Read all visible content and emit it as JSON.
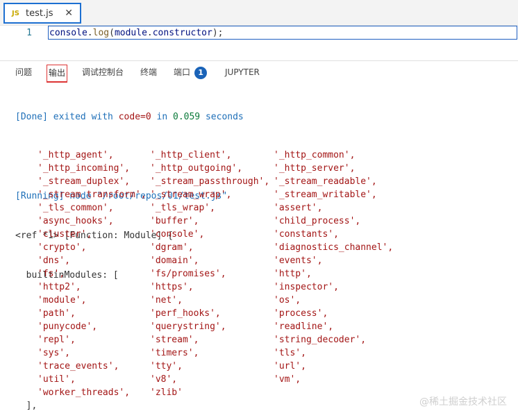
{
  "tab": {
    "icon": "JS",
    "file_name": "test.js",
    "close": "✕"
  },
  "editor": {
    "line_number": "1",
    "code": {
      "object": "console",
      "dot1": ".",
      "method": "log",
      "open": "(",
      "arg_obj": "module",
      "dot2": ".",
      "arg_prop": "constructor",
      "close": ");"
    }
  },
  "panel": {
    "tabs": [
      "问题",
      "输出",
      "调试控制台",
      "终端",
      "端口",
      "JUPYTER"
    ],
    "ports_badge": "1"
  },
  "output": {
    "done_tag": "[Done]",
    "done_text": " exited with ",
    "code_label": "code=0",
    "done_in": " in ",
    "done_seconds": "0.059",
    "done_unit": " seconds",
    "running_tag": "[Running]",
    "running_cmd": " node \"/root/repos/01/test.js\"",
    "ref_line": "<ref *1> [Function: Module] {",
    "builtin_header": "  builtinModules: [",
    "modules": [
      [
        "'_http_agent',",
        "'_http_client',",
        "'_http_common',"
      ],
      [
        "'_http_incoming',",
        "'_http_outgoing',",
        "'_http_server',"
      ],
      [
        "'_stream_duplex',",
        "'_stream_passthrough',",
        "'_stream_readable',"
      ],
      [
        "'_stream_transform',",
        "'_stream_wrap',",
        "'_stream_writable',"
      ],
      [
        "'_tls_common',",
        "'_tls_wrap',",
        "'assert',"
      ],
      [
        "'async_hooks',",
        "'buffer',",
        "'child_process',"
      ],
      [
        "'cluster',",
        "'console',",
        "'constants',"
      ],
      [
        "'crypto',",
        "'dgram',",
        "'diagnostics_channel',"
      ],
      [
        "'dns',",
        "'domain',",
        "'events',"
      ],
      [
        "'fs',",
        "'fs/promises',",
        "'http',"
      ],
      [
        "'http2',",
        "'https',",
        "'inspector',"
      ],
      [
        "'module',",
        "'net',",
        "'os',"
      ],
      [
        "'path',",
        "'perf_hooks',",
        "'process',"
      ],
      [
        "'punycode',",
        "'querystring',",
        "'readline',"
      ],
      [
        "'repl',",
        "'stream',",
        "'string_decoder',"
      ],
      [
        "'sys',",
        "'timers',",
        "'tls',"
      ],
      [
        "'trace_events',",
        "'tty',",
        "'url',"
      ],
      [
        "'util',",
        "'v8',",
        "'vm',"
      ],
      [
        "'worker_threads',",
        "'zlib'",
        ""
      ]
    ],
    "closing": "  ],"
  },
  "watermark": "@稀土掘金技术社区"
}
